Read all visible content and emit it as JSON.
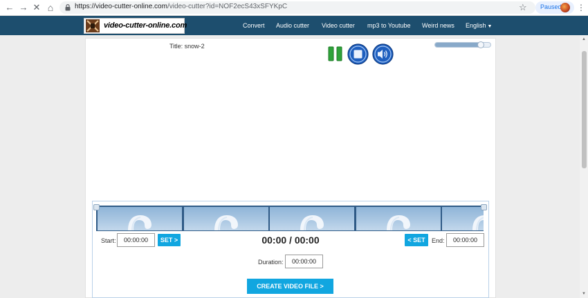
{
  "browser": {
    "back_glyph": "←",
    "forward_glyph": "→",
    "stop_glyph": "✕",
    "home_glyph": "⌂",
    "url_host": "https://video-cutter-online.com",
    "url_path": "/video-cutter?id=NOF2ecS43xSFYKpC",
    "star_glyph": "☆",
    "profile_status": "Paused",
    "menu_glyph": "⋮"
  },
  "site": {
    "logo_text": "video-cutter-online.com",
    "nav": {
      "convert": "Convert",
      "audio_cutter": "Audio cutter",
      "video_cutter": "Video cutter",
      "mp3_to_youtube": "mp3 to Youtube",
      "weird_news": "Weird news",
      "language": "English"
    }
  },
  "player": {
    "title": "Title: snow-2",
    "volume_level": 0.82,
    "icons": [
      "pause-icon",
      "stop-icon",
      "speaker-icon"
    ]
  },
  "timeline": {
    "frame_count": 5,
    "start_label": "Start:",
    "start_value": "00:00:00",
    "set_start_label": "SET >",
    "time_display": "00:00 / 00:00",
    "set_end_label": "< SET",
    "end_label": "End:",
    "end_value": "00:00:00",
    "duration_label": "Duration:",
    "duration_value": "00:00:00",
    "create_label": "CREATE VIDEO FILE >"
  },
  "colors": {
    "nav_bg": "#1d4e6e",
    "accent": "#11a6e0",
    "filmstrip": "#2f5a86"
  }
}
